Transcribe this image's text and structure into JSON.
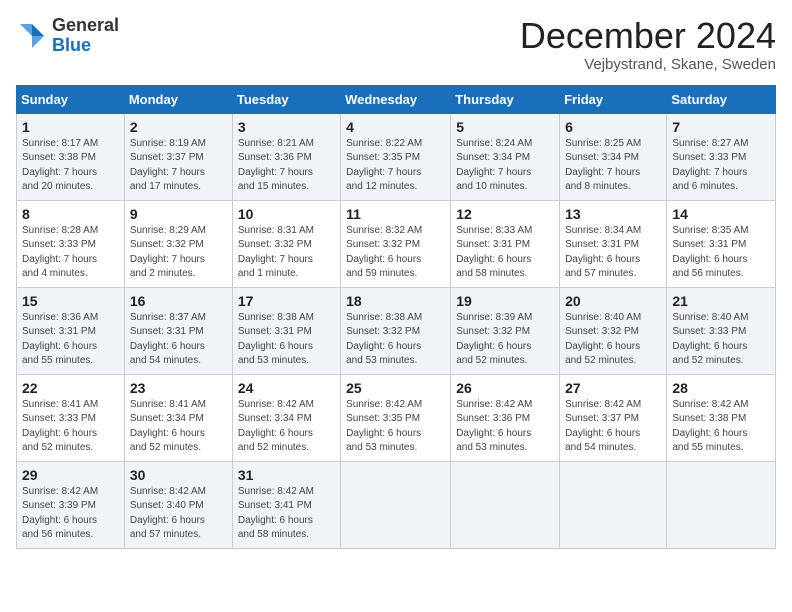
{
  "header": {
    "logo_general": "General",
    "logo_blue": "Blue",
    "month_title": "December 2024",
    "location": "Vejbystrand, Skane, Sweden"
  },
  "weekdays": [
    "Sunday",
    "Monday",
    "Tuesday",
    "Wednesday",
    "Thursday",
    "Friday",
    "Saturday"
  ],
  "weeks": [
    [
      {
        "day": "1",
        "info": "Sunrise: 8:17 AM\nSunset: 3:38 PM\nDaylight: 7 hours\nand 20 minutes."
      },
      {
        "day": "2",
        "info": "Sunrise: 8:19 AM\nSunset: 3:37 PM\nDaylight: 7 hours\nand 17 minutes."
      },
      {
        "day": "3",
        "info": "Sunrise: 8:21 AM\nSunset: 3:36 PM\nDaylight: 7 hours\nand 15 minutes."
      },
      {
        "day": "4",
        "info": "Sunrise: 8:22 AM\nSunset: 3:35 PM\nDaylight: 7 hours\nand 12 minutes."
      },
      {
        "day": "5",
        "info": "Sunrise: 8:24 AM\nSunset: 3:34 PM\nDaylight: 7 hours\nand 10 minutes."
      },
      {
        "day": "6",
        "info": "Sunrise: 8:25 AM\nSunset: 3:34 PM\nDaylight: 7 hours\nand 8 minutes."
      },
      {
        "day": "7",
        "info": "Sunrise: 8:27 AM\nSunset: 3:33 PM\nDaylight: 7 hours\nand 6 minutes."
      }
    ],
    [
      {
        "day": "8",
        "info": "Sunrise: 8:28 AM\nSunset: 3:33 PM\nDaylight: 7 hours\nand 4 minutes."
      },
      {
        "day": "9",
        "info": "Sunrise: 8:29 AM\nSunset: 3:32 PM\nDaylight: 7 hours\nand 2 minutes."
      },
      {
        "day": "10",
        "info": "Sunrise: 8:31 AM\nSunset: 3:32 PM\nDaylight: 7 hours\nand 1 minute."
      },
      {
        "day": "11",
        "info": "Sunrise: 8:32 AM\nSunset: 3:32 PM\nDaylight: 6 hours\nand 59 minutes."
      },
      {
        "day": "12",
        "info": "Sunrise: 8:33 AM\nSunset: 3:31 PM\nDaylight: 6 hours\nand 58 minutes."
      },
      {
        "day": "13",
        "info": "Sunrise: 8:34 AM\nSunset: 3:31 PM\nDaylight: 6 hours\nand 57 minutes."
      },
      {
        "day": "14",
        "info": "Sunrise: 8:35 AM\nSunset: 3:31 PM\nDaylight: 6 hours\nand 56 minutes."
      }
    ],
    [
      {
        "day": "15",
        "info": "Sunrise: 8:36 AM\nSunset: 3:31 PM\nDaylight: 6 hours\nand 55 minutes."
      },
      {
        "day": "16",
        "info": "Sunrise: 8:37 AM\nSunset: 3:31 PM\nDaylight: 6 hours\nand 54 minutes."
      },
      {
        "day": "17",
        "info": "Sunrise: 8:38 AM\nSunset: 3:31 PM\nDaylight: 6 hours\nand 53 minutes."
      },
      {
        "day": "18",
        "info": "Sunrise: 8:38 AM\nSunset: 3:32 PM\nDaylight: 6 hours\nand 53 minutes."
      },
      {
        "day": "19",
        "info": "Sunrise: 8:39 AM\nSunset: 3:32 PM\nDaylight: 6 hours\nand 52 minutes."
      },
      {
        "day": "20",
        "info": "Sunrise: 8:40 AM\nSunset: 3:32 PM\nDaylight: 6 hours\nand 52 minutes."
      },
      {
        "day": "21",
        "info": "Sunrise: 8:40 AM\nSunset: 3:33 PM\nDaylight: 6 hours\nand 52 minutes."
      }
    ],
    [
      {
        "day": "22",
        "info": "Sunrise: 8:41 AM\nSunset: 3:33 PM\nDaylight: 6 hours\nand 52 minutes."
      },
      {
        "day": "23",
        "info": "Sunrise: 8:41 AM\nSunset: 3:34 PM\nDaylight: 6 hours\nand 52 minutes."
      },
      {
        "day": "24",
        "info": "Sunrise: 8:42 AM\nSunset: 3:34 PM\nDaylight: 6 hours\nand 52 minutes."
      },
      {
        "day": "25",
        "info": "Sunrise: 8:42 AM\nSunset: 3:35 PM\nDaylight: 6 hours\nand 53 minutes."
      },
      {
        "day": "26",
        "info": "Sunrise: 8:42 AM\nSunset: 3:36 PM\nDaylight: 6 hours\nand 53 minutes."
      },
      {
        "day": "27",
        "info": "Sunrise: 8:42 AM\nSunset: 3:37 PM\nDaylight: 6 hours\nand 54 minutes."
      },
      {
        "day": "28",
        "info": "Sunrise: 8:42 AM\nSunset: 3:38 PM\nDaylight: 6 hours\nand 55 minutes."
      }
    ],
    [
      {
        "day": "29",
        "info": "Sunrise: 8:42 AM\nSunset: 3:39 PM\nDaylight: 6 hours\nand 56 minutes."
      },
      {
        "day": "30",
        "info": "Sunrise: 8:42 AM\nSunset: 3:40 PM\nDaylight: 6 hours\nand 57 minutes."
      },
      {
        "day": "31",
        "info": "Sunrise: 8:42 AM\nSunset: 3:41 PM\nDaylight: 6 hours\nand 58 minutes."
      },
      null,
      null,
      null,
      null
    ]
  ]
}
